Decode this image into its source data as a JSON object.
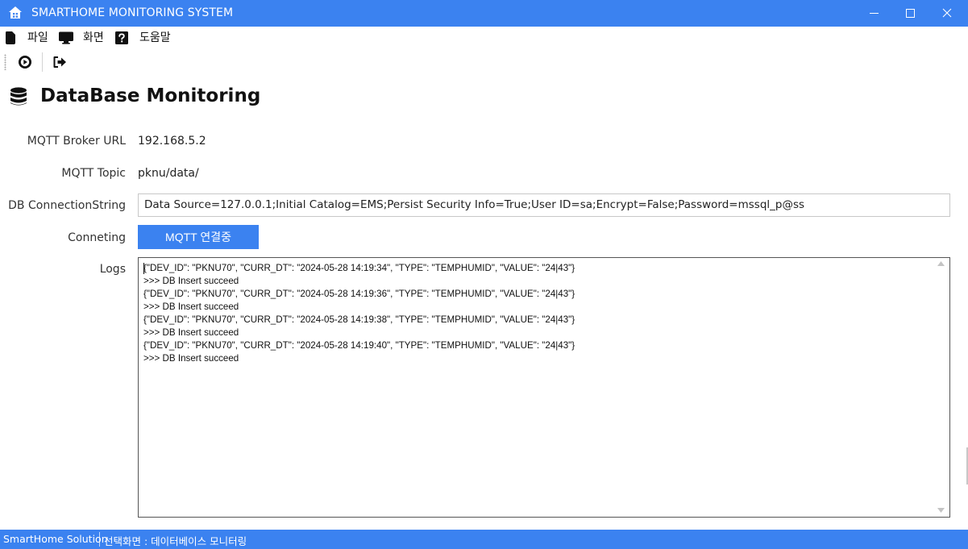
{
  "window": {
    "title": "SMARTHOME MONITORING SYSTEM",
    "icon": "smarthome-icon",
    "controls": [
      "minimize-icon",
      "maximize-icon",
      "close-icon"
    ]
  },
  "menu": {
    "items": [
      {
        "label": "파일",
        "icon": "file-icon"
      },
      {
        "label": "화면",
        "icon": "monitor-icon"
      },
      {
        "label": "도움말",
        "icon": "help-icon"
      }
    ]
  },
  "toolbar": {
    "buttons": [
      {
        "icon": "play-circle-icon"
      },
      {
        "icon": "exit-icon"
      }
    ]
  },
  "page": {
    "title": "DataBase Monitoring",
    "icon": "database-icon"
  },
  "form": {
    "broker_label": "MQTT Broker URL",
    "broker_value": "192.168.5.2",
    "topic_label": "MQTT Topic",
    "topic_value": "pknu/data/",
    "conn_label": "DB ConnectionString",
    "conn_value": "Data Source=127.0.0.1;Initial Catalog=EMS;Persist Security Info=True;User ID=sa;Encrypt=False;Password=mssql_p@ss",
    "connecting_label": "Conneting",
    "mqtt_button": "MQTT 연결중",
    "logs_label": "Logs"
  },
  "logs": [
    "{\"DEV_ID\": \"PKNU70\", \"CURR_DT\": \"2024-05-28 14:19:34\", \"TYPE\": \"TEMPHUMID\", \"VALUE\": \"24|43\"}",
    ">>> DB Insert succeed",
    "{\"DEV_ID\": \"PKNU70\", \"CURR_DT\": \"2024-05-28 14:19:36\", \"TYPE\": \"TEMPHUMID\", \"VALUE\": \"24|43\"}",
    ">>> DB Insert succeed",
    "{\"DEV_ID\": \"PKNU70\", \"CURR_DT\": \"2024-05-28 14:19:38\", \"TYPE\": \"TEMPHUMID\", \"VALUE\": \"24|43\"}",
    ">>> DB Insert succeed",
    "{\"DEV_ID\": \"PKNU70\", \"CURR_DT\": \"2024-05-28 14:19:40\", \"TYPE\": \"TEMPHUMID\", \"VALUE\": \"24|43\"}",
    ">>> DB Insert succeed"
  ],
  "status": {
    "solution": "SmartHome Solution",
    "selected_screen": "선택화면 : 데이터베이스 모니터링"
  },
  "colors": {
    "accent": "#3b82f0",
    "text": "#222222"
  }
}
